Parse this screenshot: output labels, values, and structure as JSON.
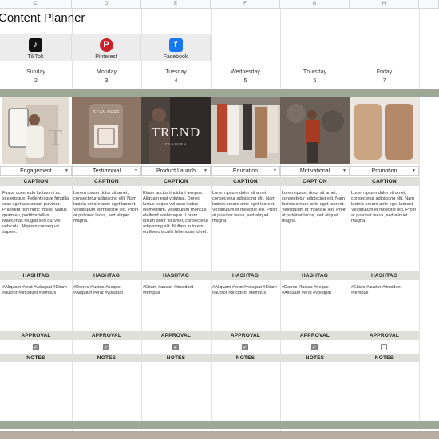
{
  "columns": [
    "C",
    "D",
    "E",
    "F",
    "G",
    "H",
    ""
  ],
  "title": "Content Planner",
  "socials": [
    {
      "label": "TikTok",
      "icon": "tiktok-icon",
      "color": "#111111",
      "glyph": "♪"
    },
    {
      "label": "Pinterest",
      "icon": "pinterest-icon",
      "color": "#c8232c",
      "glyph": "P"
    },
    {
      "label": "Facebook",
      "icon": "facebook-icon",
      "color": "#1877f2",
      "glyph": "f"
    }
  ],
  "days": [
    {
      "name": "Sunday",
      "num": "2",
      "category": "Engagement",
      "caption": "Fusce commodo luctus mi ac scelerisque. Pellentesque fringilla eras eget accumsan pulvinar. Praesent non nunc mollis, varius quam eu, porttitor tellus. Maecenas feugiat sed dui vel vehicula. Aliquam consequat sapien.",
      "hashtag": "#Aliquam #erat #volutpat #Etiam #auctor #tincidunt #tempus",
      "approved": true
    },
    {
      "name": "Monday",
      "num": "3",
      "category": "Testimonial",
      "caption": "Lorem ipsum dolor sit amet, consectetur adipiscing elit. Nam lacinia ornare ante eget laoreet. Vestibulum et molestie leo. Proin at pulvinar lacus, sed aliquet magna.",
      "hashtag": "#Donec #luctus #neque #Aliquam #erat #volutpat",
      "approved": true
    },
    {
      "name": "Tuesday",
      "num": "4",
      "category": "Product Launch",
      "caption": "Etiam auctor tincidunt tempus. Aliquam erat volutpat. Donec luctus neque vel arcu luctus elementum. Vestibulum rhoncus eleifend scelerisque. Lorem ipsum dolor sit amet, consectetur adipiscing elit. Nullam in lorem eu libero iaculis bibendum id vel.",
      "hashtag": "#Etiam #auctor #tincidunt #tempus",
      "approved": true
    },
    {
      "name": "Wednesday",
      "num": "5",
      "category": "Education",
      "caption": "Lorem ipsum dolor sit amet, consectetur adipiscing elit. Nam lacinia ornare ante eget laoreet. Vestibulum et molestie leo. Proin at pulvinar lacus, sed aliquet magna.",
      "hashtag": "#Aliquam #erat #volutpat #Etiam #auctor #tincidunt #tempus",
      "approved": true
    },
    {
      "name": "Thursday",
      "num": "6",
      "category": "Motivational",
      "caption": "Lorem ipsum dolor sit amet, consectetur adipiscing elit. Nam lacinia ornare ante eget laoreet. Vestibulum et molestie leo. Proin at pulvinar lacus, sed aliquet magna.",
      "hashtag": "#Donec #luctus #neque #Aliquam #erat #volutpat",
      "approved": true
    },
    {
      "name": "Friday",
      "num": "7",
      "category": "Promotion",
      "caption": "Lorem ipsum dolor sit amet, consectetur adipiscing elit. Nam lacinia ornare ante eget laoreet. Vestibulum et molestie leo. Proin at pulvinar lacus, sed aliquet magna.",
      "hashtag": "#Etiam #auctor #tincidunt #tempus",
      "approved": false
    }
  ],
  "photo_text": {
    "monday_line1": "SCAN HERE",
    "tuesday_big": "TREND",
    "tuesday_small": "FASHION"
  },
  "labels": {
    "caption": "CAPTION",
    "hashtag": "HASHTAG",
    "approval": "APPROVAL",
    "notes": "NOTES",
    "check": "✓"
  },
  "colors": {
    "band": "#9fa796",
    "section": "#dfe0da"
  }
}
